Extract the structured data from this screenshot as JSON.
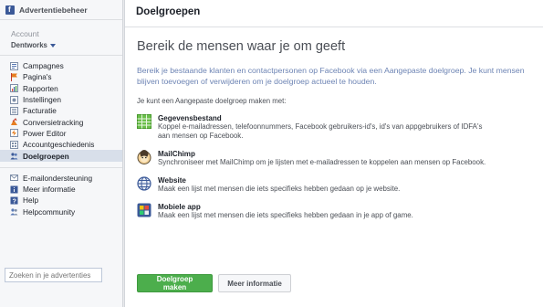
{
  "sidebar": {
    "title": "Advertentiebeheer",
    "account_label": "Account",
    "account_name": "Dentworks",
    "items": [
      {
        "label": "Campagnes",
        "icon": "campaigns-icon"
      },
      {
        "label": "Pagina's",
        "icon": "pages-icon"
      },
      {
        "label": "Rapporten",
        "icon": "reports-icon"
      },
      {
        "label": "Instellingen",
        "icon": "settings-icon"
      },
      {
        "label": "Facturatie",
        "icon": "billing-icon"
      },
      {
        "label": "Conversietracking",
        "icon": "conversion-icon"
      },
      {
        "label": "Power Editor",
        "icon": "power-editor-icon"
      },
      {
        "label": "Accountgeschiedenis",
        "icon": "history-icon"
      },
      {
        "label": "Doelgroepen",
        "icon": "audiences-icon"
      }
    ],
    "support_items": [
      {
        "label": "E-mailondersteuning",
        "icon": "email-icon"
      },
      {
        "label": "Meer informatie",
        "icon": "info-icon"
      },
      {
        "label": "Help",
        "icon": "help-icon"
      },
      {
        "label": "Helpcommunity",
        "icon": "community-icon"
      }
    ],
    "search_placeholder": "Zoeken in je advertenties"
  },
  "main": {
    "title": "Doelgroepen",
    "headline": "Bereik de mensen waar je om geeft",
    "intro": "Bereik je bestaande klanten en contactpersonen op Facebook via een Aangepaste doelgroep. Je kunt mensen blijven toevoegen of verwijderen om je doelgroep actueel te houden.",
    "can_make": "Je kunt een Aangepaste doelgroep maken met:",
    "options": [
      {
        "title": "Gegevensbestand",
        "desc": "Koppel e-mailadressen, telefoonnummers, Facebook gebruikers-id's, id's van appgebruikers of IDFA's aan mensen op Facebook.",
        "icon": "data-file-icon"
      },
      {
        "title": "MailChimp",
        "desc": "Synchroniseer met MailChimp om je lijsten met e-mailadressen te koppelen aan mensen op Facebook.",
        "icon": "mailchimp-icon"
      },
      {
        "title": "Website",
        "desc": "Maak een lijst met mensen die iets specifieks hebben gedaan op je website.",
        "icon": "website-icon"
      },
      {
        "title": "Mobiele app",
        "desc": "Maak een lijst met mensen die iets specifieks hebben gedaan in je app of game.",
        "icon": "mobile-app-icon"
      }
    ],
    "primary_button": "Doelgroep maken",
    "secondary_button": "Meer informatie"
  },
  "colors": {
    "brand": "#3b5998",
    "primary_button": "#4cae4c",
    "intro_text": "#6d84b4",
    "active_item_bg": "#d8dfea"
  }
}
